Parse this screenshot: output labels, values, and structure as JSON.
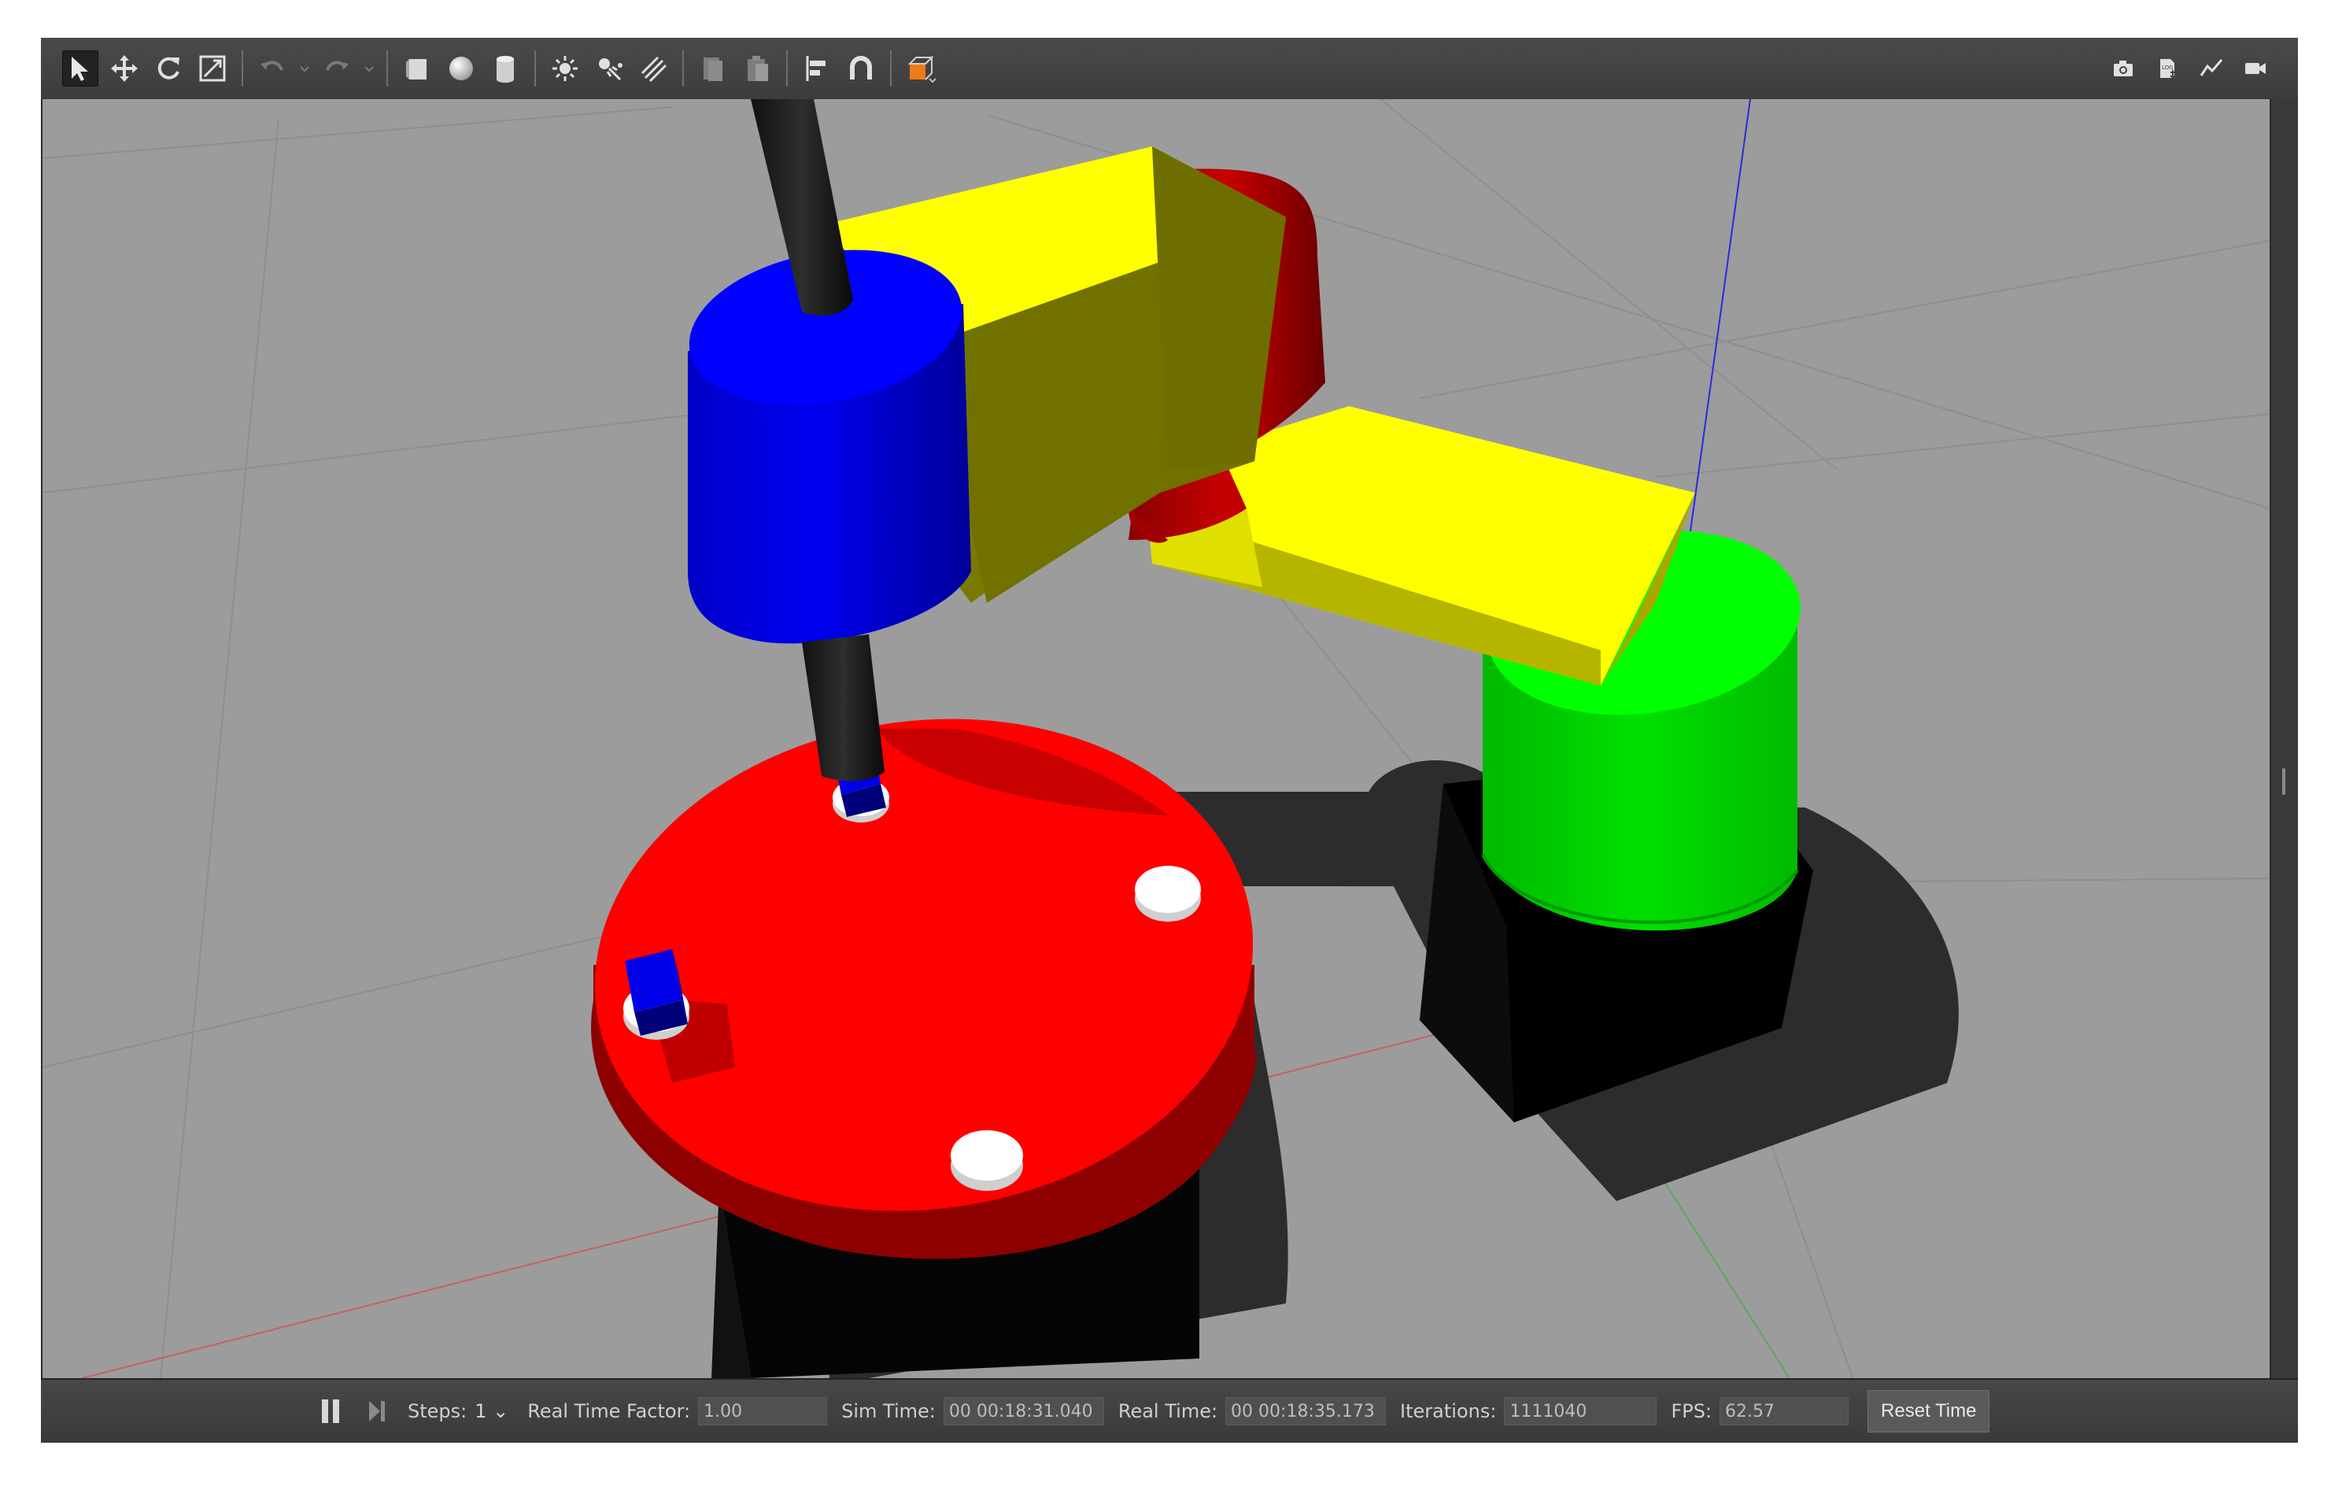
{
  "toolbar": {
    "tools": [
      {
        "name": "select-mode",
        "icon": "arrow-pointer-icon",
        "active": true
      },
      {
        "name": "translate-mode",
        "icon": "move-arrows-icon"
      },
      {
        "name": "rotate-mode",
        "icon": "rotate-icon"
      },
      {
        "name": "scale-mode",
        "icon": "scale-icon"
      },
      {
        "name": "undo",
        "icon": "undo-icon"
      },
      {
        "name": "redo",
        "icon": "redo-icon"
      },
      {
        "name": "box-shape",
        "icon": "box-icon"
      },
      {
        "name": "sphere-shape",
        "icon": "sphere-icon"
      },
      {
        "name": "cylinder-shape",
        "icon": "cylinder-icon"
      },
      {
        "name": "point-light",
        "icon": "point-light-icon"
      },
      {
        "name": "spot-light",
        "icon": "spot-light-icon"
      },
      {
        "name": "directional-light",
        "icon": "directional-light-icon"
      },
      {
        "name": "copy",
        "icon": "copy-icon"
      },
      {
        "name": "paste",
        "icon": "paste-icon"
      },
      {
        "name": "align",
        "icon": "align-icon"
      },
      {
        "name": "snap",
        "icon": "magnet-icon"
      },
      {
        "name": "view-angle",
        "icon": "view-cube-icon"
      }
    ],
    "right_tools": [
      {
        "name": "screenshot",
        "icon": "camera-icon"
      },
      {
        "name": "log",
        "icon": "log-icon"
      },
      {
        "name": "plot",
        "icon": "plot-icon"
      },
      {
        "name": "record-video",
        "icon": "video-camera-icon"
      }
    ]
  },
  "statusbar": {
    "steps_label": "Steps:",
    "steps_value": "1",
    "rtf_label": "Real Time Factor:",
    "rtf_value": "1.00",
    "sim_time_label": "Sim Time:",
    "sim_time_value": "00 00:18:31.040",
    "real_time_label": "Real Time:",
    "real_time_value": "00 00:18:35.173",
    "iterations_label": "Iterations:",
    "iterations_value": "1111040",
    "fps_label": "FPS:",
    "fps_value": "62.57",
    "reset_label": "Reset Time"
  },
  "colors": {
    "ground": "#9c9c9c",
    "link_yellow": "#ffff00",
    "joint_blue": "#0000ff",
    "joint_red": "#ff0000",
    "joint_green": "#00e600",
    "base_black": "#000000",
    "table_red": "#ff0000",
    "cube_blue": "#0000ee",
    "puck_white": "#ffffff"
  }
}
